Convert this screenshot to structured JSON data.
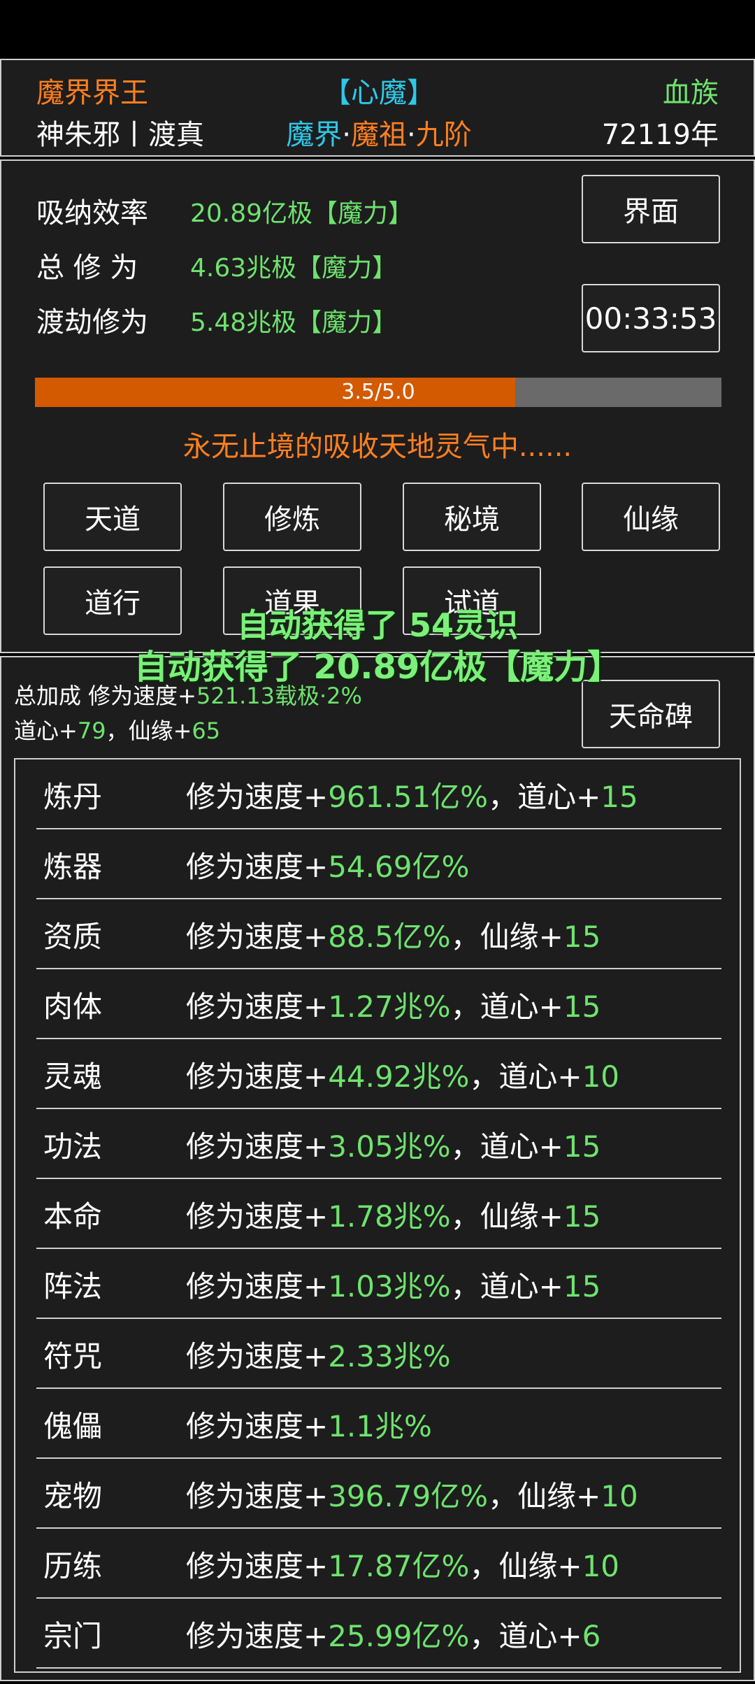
{
  "header": {
    "realm_title": "魔界界王",
    "inner_demon": "【心魔】",
    "race": "血族",
    "character_name": "神朱邪丨渡真",
    "stage": {
      "part1": "魔界",
      "sep1": "·",
      "part2": "魔祖",
      "sep2": "·",
      "part3": "九阶"
    },
    "age": "72119年"
  },
  "stats": {
    "absorb_label": "吸纳效率",
    "absorb_value": "20.89亿极【魔力】",
    "total_label": "总 修 为",
    "total_value": "4.63兆极【魔力】",
    "tribulation_label": "渡劫修为",
    "tribulation_value": "5.48兆极【魔力】",
    "interface_button": "界面",
    "timer": "00:33:53"
  },
  "progress": {
    "text": "3.5/5.0",
    "value": 3.5,
    "max": 5.0,
    "fill_color": "#d45a00",
    "track_color": "#6a6a6a"
  },
  "status_message": "永无止境的吸收天地灵气中......",
  "action_buttons": [
    "天道",
    "修炼",
    "秘境",
    "仙缘",
    "道行",
    "道果",
    "试道"
  ],
  "toasts": [
    "自动获得了 54灵识",
    "自动获得了 20.89亿极【魔力】"
  ],
  "bonus": {
    "line1_prefix": "总加成 修为速度+",
    "line1_value": "521.13载极",
    "line1_suffix": "·2%",
    "line2_a_label": "道心+",
    "line2_a_value": "79",
    "line2_sep": "，",
    "line2_b_label": "仙缘+",
    "line2_b_value": "65",
    "tianming_button": "天命碑"
  },
  "rows": [
    {
      "name": "炼丹",
      "prefix": "修为速度+",
      "value": "961.51亿%",
      "extra_label": "，道心+",
      "extra_value": "15"
    },
    {
      "name": "炼器",
      "prefix": "修为速度+",
      "value": "54.69亿%",
      "extra_label": "",
      "extra_value": ""
    },
    {
      "name": "资质",
      "prefix": "修为速度+",
      "value": "88.5亿%",
      "extra_label": "，仙缘+",
      "extra_value": "15"
    },
    {
      "name": "肉体",
      "prefix": "修为速度+",
      "value": "1.27兆%",
      "extra_label": "，道心+",
      "extra_value": "15"
    },
    {
      "name": "灵魂",
      "prefix": "修为速度+",
      "value": "44.92兆%",
      "extra_label": "，道心+",
      "extra_value": "10"
    },
    {
      "name": "功法",
      "prefix": "修为速度+",
      "value": "3.05兆%",
      "extra_label": "，道心+",
      "extra_value": "15"
    },
    {
      "name": "本命",
      "prefix": "修为速度+",
      "value": "1.78兆%",
      "extra_label": "，仙缘+",
      "extra_value": "15"
    },
    {
      "name": "阵法",
      "prefix": "修为速度+",
      "value": "1.03兆%",
      "extra_label": "，道心+",
      "extra_value": "15"
    },
    {
      "name": "符咒",
      "prefix": "修为速度+",
      "value": "2.33兆%",
      "extra_label": "",
      "extra_value": ""
    },
    {
      "name": "傀儡",
      "prefix": "修为速度+",
      "value": "1.1兆%",
      "extra_label": "",
      "extra_value": ""
    },
    {
      "name": "宠物",
      "prefix": "修为速度+",
      "value": "396.79亿%",
      "extra_label": "，仙缘+",
      "extra_value": "10"
    },
    {
      "name": "历练",
      "prefix": "修为速度+",
      "value": "17.87亿%",
      "extra_label": "，仙缘+",
      "extra_value": "10"
    },
    {
      "name": "宗门",
      "prefix": "修为速度+",
      "value": "25.99亿%",
      "extra_label": "，道心+",
      "extra_value": "6"
    }
  ]
}
